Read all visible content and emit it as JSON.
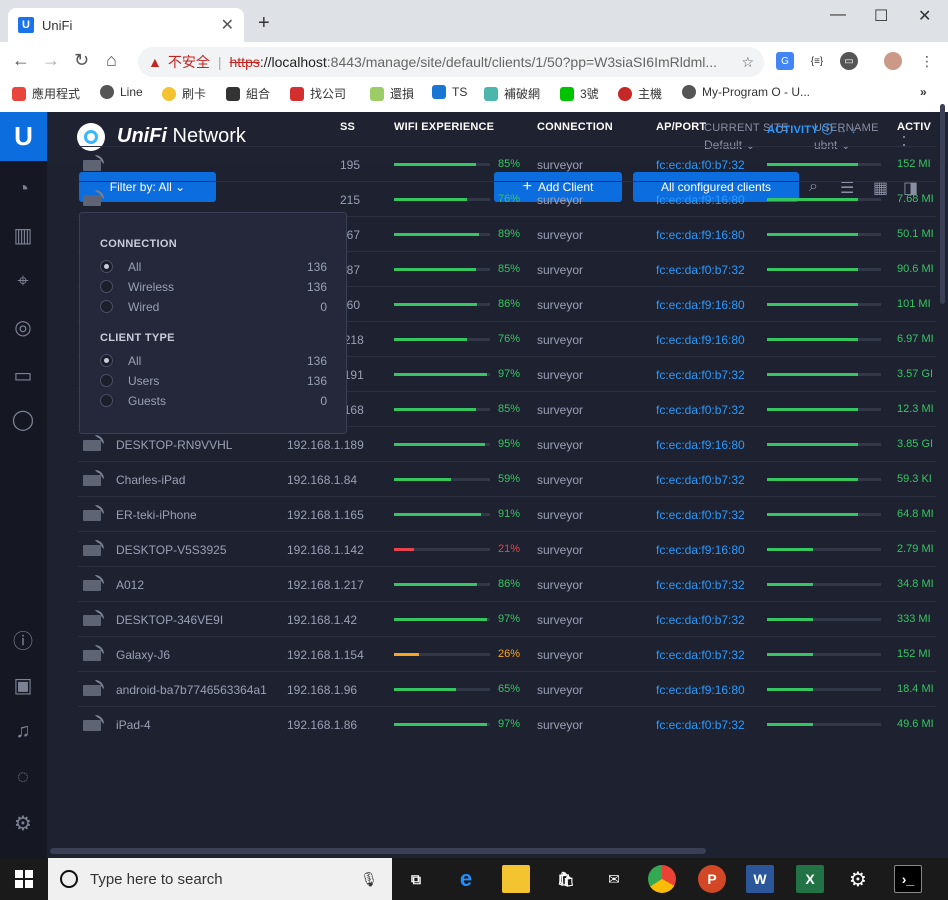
{
  "browser": {
    "tab_title": "UniFi",
    "tab_favicon": "U",
    "url_warning": "不安全",
    "url_scheme": "https",
    "url_host": "://localhost",
    "url_path": ":8443/manage/site/default/clients/1/50?pp=W3siaSI6ImRldml...",
    "bookmarks": [
      "應用程式",
      "Line",
      "刷卡",
      "組合",
      "找公司",
      "還損",
      "TS",
      "補破網",
      "3號",
      "主機",
      "My-Program O - U..."
    ]
  },
  "header": {
    "brand_italic": "UniFi",
    "brand_rest": " Network",
    "site_label": "CURRENT SITE",
    "site_value": "Default",
    "user_label": "USERNAME",
    "user_value": "ubnt"
  },
  "toolbar": {
    "filter_label": "Filter by: All",
    "add_client_label": "Add Client",
    "configured_label": "All configured clients"
  },
  "table": {
    "headers": {
      "ip_partial": "SS",
      "wifi": "WIFI EXPERIENCE",
      "connection": "CONNECTION",
      "ap_port": "AP/PORT",
      "activity": "ACTIVITY",
      "activ_partial": "ACTIV"
    },
    "rows": [
      {
        "name": "",
        "ip": "195",
        "wifi": 85,
        "wifi_label": "85%",
        "conn": "surveyor",
        "mac": "fc:ec:da:f0:b7:32",
        "act": 0.8,
        "act_val": "152 MI"
      },
      {
        "name": "",
        "ip": "215",
        "wifi": 76,
        "wifi_label": "76%",
        "conn": "surveyor",
        "mac": "fc:ec:da:f9:16:80",
        "act": 0.8,
        "act_val": "7.68 MI"
      },
      {
        "name": "",
        "ip": "167",
        "wifi": 89,
        "wifi_label": "89%",
        "conn": "surveyor",
        "mac": "fc:ec:da:f9:16:80",
        "act": 0.8,
        "act_val": "50.1 MI"
      },
      {
        "name": "",
        "ip": "187",
        "wifi": 85,
        "wifi_label": "85%",
        "conn": "surveyor",
        "mac": "fc:ec:da:f0:b7:32",
        "act": 0.8,
        "act_val": "90.6 MI"
      },
      {
        "name": "",
        "ip": "160",
        "wifi": 86,
        "wifi_label": "86%",
        "conn": "surveyor",
        "mac": "fc:ec:da:f9:16:80",
        "act": 0.8,
        "act_val": "101 MI"
      },
      {
        "name": "DESKTOP-RRE1P7R",
        "ip": "192.168.1.218",
        "wifi": 76,
        "wifi_label": "76%",
        "conn": "surveyor",
        "mac": "fc:ec:da:f9:16:80",
        "act": 0.8,
        "act_val": "6.97 MI"
      },
      {
        "name": "NB-0398",
        "ip": "192.168.1.191",
        "wifi": 97,
        "wifi_label": "97%",
        "conn": "surveyor",
        "mac": "fc:ec:da:f0:b7:32",
        "act": 0.8,
        "act_val": "3.57 GI"
      },
      {
        "name": "YuehHsiaMacBook",
        "ip": "192.168.1.168",
        "wifi": 85,
        "wifi_label": "85%",
        "conn": "surveyor",
        "mac": "fc:ec:da:f0:b7:32",
        "act": 0.8,
        "act_val": "12.3 MI"
      },
      {
        "name": "DESKTOP-RN9VVHL",
        "ip": "192.168.1.189",
        "wifi": 95,
        "wifi_label": "95%",
        "conn": "surveyor",
        "mac": "fc:ec:da:f9:16:80",
        "act": 0.8,
        "act_val": "3.85 GI"
      },
      {
        "name": "Charles-iPad",
        "ip": "192.168.1.84",
        "wifi": 59,
        "wifi_label": "59%",
        "conn": "surveyor",
        "mac": "fc:ec:da:f0:b7:32",
        "act": 0.8,
        "act_val": "59.3 KI"
      },
      {
        "name": "ER-teki-iPhone",
        "ip": "192.168.1.165",
        "wifi": 91,
        "wifi_label": "91%",
        "conn": "surveyor",
        "mac": "fc:ec:da:f0:b7:32",
        "act": 0.8,
        "act_val": "64.8 MI"
      },
      {
        "name": "DESKTOP-V5S3925",
        "ip": "192.168.1.142",
        "wifi": 21,
        "wifi_label": "21%",
        "conn": "surveyor",
        "mac": "fc:ec:da:f9:16:80",
        "act": 0.4,
        "act_val": "2.79 MI"
      },
      {
        "name": "A012",
        "ip": "192.168.1.217",
        "wifi": 86,
        "wifi_label": "86%",
        "conn": "surveyor",
        "mac": "fc:ec:da:f0:b7:32",
        "act": 0.4,
        "act_val": "34.8 MI"
      },
      {
        "name": "DESKTOP-346VE9I",
        "ip": "192.168.1.42",
        "wifi": 97,
        "wifi_label": "97%",
        "conn": "surveyor",
        "mac": "fc:ec:da:f0:b7:32",
        "act": 0.4,
        "act_val": "333 MI"
      },
      {
        "name": "Galaxy-J6",
        "ip": "192.168.1.154",
        "wifi": 26,
        "wifi_label": "26%",
        "conn": "surveyor",
        "mac": "fc:ec:da:f0:b7:32",
        "act": 0.4,
        "act_val": "152 MI"
      },
      {
        "name": "android-ba7b7746563364a1",
        "ip": "192.168.1.96",
        "wifi": 65,
        "wifi_label": "65%",
        "conn": "surveyor",
        "mac": "fc:ec:da:f9:16:80",
        "act": 0.4,
        "act_val": "18.4 MI"
      },
      {
        "name": "iPad-4",
        "ip": "192.168.1.86",
        "wifi": 97,
        "wifi_label": "97%",
        "conn": "surveyor",
        "mac": "fc:ec:da:f0:b7:32",
        "act": 0.4,
        "act_val": "49.6 MI"
      }
    ]
  },
  "filter_dropdown": {
    "connection_heading": "CONNECTION",
    "connection": [
      {
        "label": "All",
        "count": "136",
        "selected": true
      },
      {
        "label": "Wireless",
        "count": "136",
        "selected": false
      },
      {
        "label": "Wired",
        "count": "0",
        "selected": false
      }
    ],
    "client_type_heading": "CLIENT TYPE",
    "client_type": [
      {
        "label": "All",
        "count": "136",
        "selected": true
      },
      {
        "label": "Users",
        "count": "136",
        "selected": false
      },
      {
        "label": "Guests",
        "count": "0",
        "selected": false
      }
    ]
  },
  "taskbar": {
    "search_placeholder": "Type here to search"
  },
  "colors": {
    "accent": "#0b6dde",
    "good": "#36c661",
    "warn": "#f5a623",
    "bad": "#e8424f",
    "mac": "#2b9bff"
  }
}
